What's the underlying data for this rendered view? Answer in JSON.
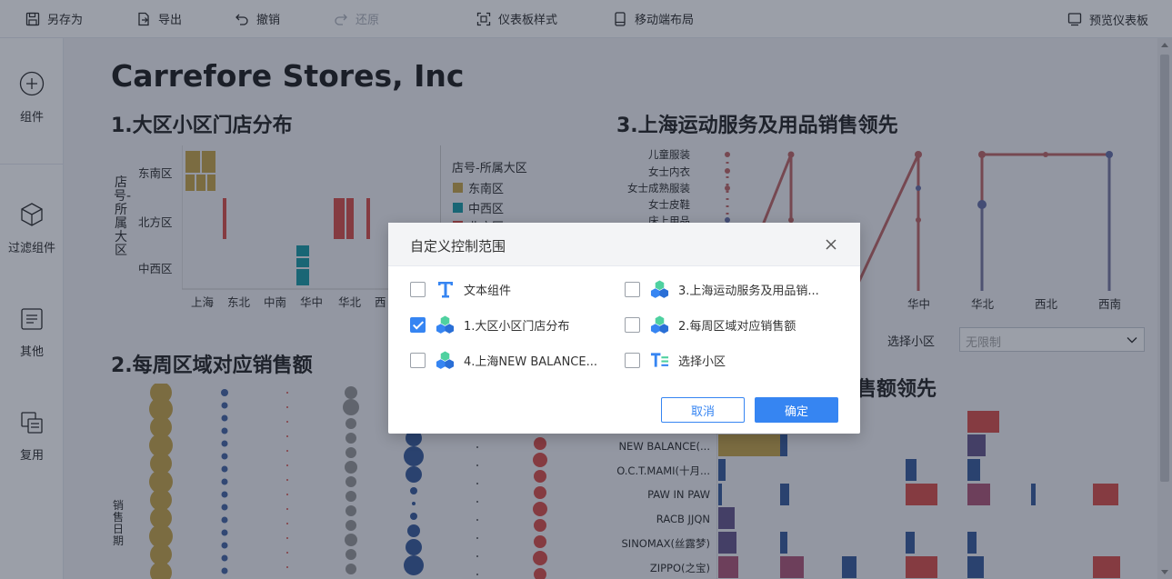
{
  "toolbar": {
    "save_as": "另存为",
    "export": "导出",
    "undo": "撤销",
    "redo": "还原",
    "dashboard_style": "仪表板样式",
    "mobile_layout": "移动端布局",
    "preview": "预览仪表板"
  },
  "sidebar": {
    "component": "组件",
    "filter_component": "过滤组件",
    "other": "其他",
    "reuse": "复用"
  },
  "dashboard": {
    "title": "Carrefore Stores, Inc",
    "widget1": {
      "title": "1.大区小区门店分布",
      "y_axis_label": "店号-所属大区",
      "rows": [
        "东南区",
        "北方区",
        "中西区"
      ],
      "cols": [
        "上海",
        "东北",
        "中南",
        "华中",
        "华北",
        "西"
      ],
      "legend_title": "店号-所属大区",
      "legend": [
        {
          "label": "东南区",
          "color": "#c8a84e"
        },
        {
          "label": "中西区",
          "color": "#1f9ea8"
        },
        {
          "label": "北方区",
          "color": "#d9534f"
        }
      ]
    },
    "widget2": {
      "title": "2.每周区域对应销售额",
      "y_axis_label": "销售日期"
    },
    "widget3": {
      "title": "3.上海运动服务及用品销售领先",
      "categories": [
        "儿童服装",
        "女士内衣",
        "女士成熟服装",
        "女士皮鞋",
        "床上用品"
      ],
      "x_labels": [
        "华中",
        "华北",
        "西北",
        "西南"
      ],
      "x_label_partial": "南"
    },
    "widget4": {
      "title_partial": "售额领先",
      "brands": [
        "NEW BALANCE(...",
        "O.C.T.MAMI(十月...",
        "PAW IN PAW",
        "RACB JJQN",
        "SINOMAX(丝露梦)",
        "ZIPPO(之宝)"
      ]
    },
    "filter": {
      "label": "选择小区",
      "placeholder": "无限制"
    }
  },
  "modal": {
    "title": "自定义控制范围",
    "options": [
      {
        "label": "文本组件",
        "checked": false,
        "icon": "text-icon"
      },
      {
        "label": "3.上海运动服务及用品销...",
        "checked": false,
        "icon": "chart-cubes-icon"
      },
      {
        "label": "1.大区小区门店分布",
        "checked": true,
        "icon": "chart-cubes-icon"
      },
      {
        "label": "2.每周区域对应销售额",
        "checked": false,
        "icon": "chart-cubes-icon"
      },
      {
        "label": "4.上海NEW BALANCE...",
        "checked": false,
        "icon": "chart-cubes-icon"
      },
      {
        "label": "选择小区",
        "checked": false,
        "icon": "text-list-icon"
      }
    ],
    "cancel": "取消",
    "confirm": "确定"
  }
}
